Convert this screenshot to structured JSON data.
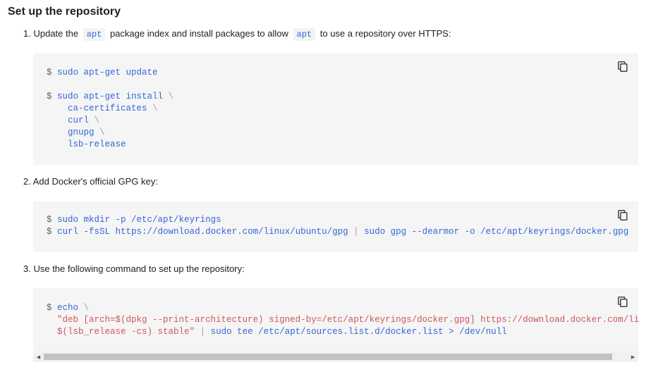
{
  "page": {
    "title": "Set up the repository"
  },
  "steps": [
    {
      "number": "1.",
      "text_a": "Update the",
      "code_a": "apt",
      "text_b": "package index and install packages to allow",
      "code_b": "apt",
      "text_c": "to use a repository over HTTPS:"
    },
    {
      "number": "2.",
      "text": "Add Docker's official GPG key:"
    },
    {
      "number": "3.",
      "text": "Use the following command to set up the repository:"
    }
  ],
  "code_blocks": {
    "block1": {
      "prompt": "$",
      "line1": "sudo apt-get update",
      "line2_cmd": "sudo apt-get install",
      "backslash": "\\",
      "pkg1": "ca-certificates",
      "pkg2": "curl",
      "pkg3": "gnupg",
      "pkg4": "lsb-release"
    },
    "block2": {
      "prompt": "$",
      "line1": "sudo mkdir -p /etc/apt/keyrings",
      "line2_a": "curl -fsSL https://download.docker.com/linux/ubuntu/gpg",
      "pipe": "|",
      "line2_b": "sudo gpg --dearmor -o /etc/apt/keyrings/docker.gpg"
    },
    "block3": {
      "prompt": "$",
      "line1": "echo",
      "backslash": "\\",
      "line2": "\"deb [arch=$(dpkg --print-architecture) signed-by=/etc/apt/keyrings/docker.gpg] https://download.docker.com/linux/",
      "line3_a": "$(lsb_release -cs) stable\"",
      "pipe": "|",
      "line3_b": "sudo tee /etc/apt/sources.list.d/docker.list > /dev/null"
    }
  },
  "icons": {
    "copy": "copy-icon",
    "scroll_left": "◀",
    "scroll_right": "▶"
  },
  "colors": {
    "command": "#3367d6",
    "string": "#d0565c",
    "code_bg": "#f5f5f5"
  }
}
